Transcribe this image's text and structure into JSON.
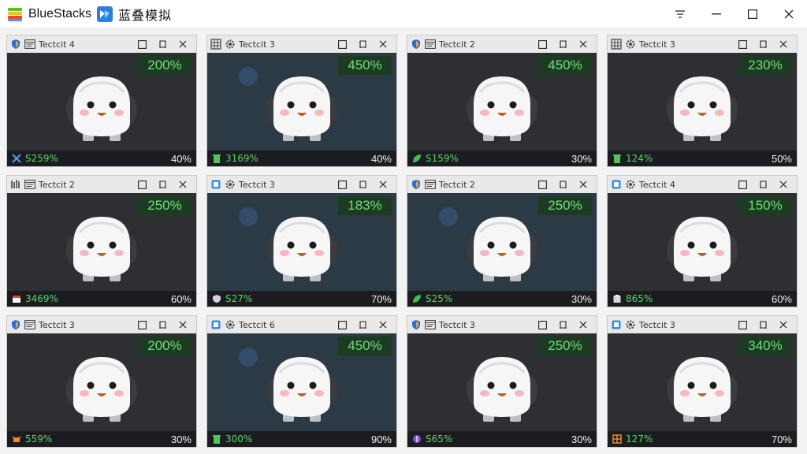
{
  "app": {
    "name": "BlueStacks",
    "alt_name": "蓝叠模拟"
  },
  "window_controls": {
    "menu_icon": "menu-icon",
    "minimize_icon": "minimize-icon",
    "maximize_icon": "maximize-icon",
    "close_icon": "close-icon"
  },
  "tiles": [
    {
      "label": "Tectcit 4",
      "zoom": "200%",
      "stat": "S259%",
      "right": "40%",
      "bg": "dark",
      "stat_icon": "cross-icon",
      "app_icon": "shield-icon"
    },
    {
      "label": "Tectcit 3",
      "zoom": "450%",
      "stat": "3169%",
      "right": "40%",
      "bg": "teal",
      "stat_icon": "trash-icon",
      "app_icon": "grid-icon"
    },
    {
      "label": "Tectcit 2",
      "zoom": "450%",
      "stat": "S159%",
      "right": "30%",
      "bg": "dark",
      "stat_icon": "leaf-icon",
      "app_icon": "shield-icon"
    },
    {
      "label": "Tectcit 3",
      "zoom": "230%",
      "stat": "124%",
      "right": "50%",
      "bg": "dark",
      "stat_icon": "trash-icon",
      "app_icon": "grid-icon"
    },
    {
      "label": "Tectcit 2",
      "zoom": "250%",
      "stat": "3469%",
      "right": "60%",
      "bg": "dark",
      "stat_icon": "calendar-icon",
      "app_icon": "bars-icon"
    },
    {
      "label": "Tectcit 3",
      "zoom": "183%",
      "stat": "S27%",
      "right": "70%",
      "bg": "teal",
      "stat_icon": "shield-small-icon",
      "app_icon": "square-icon"
    },
    {
      "label": "Tectcit 2",
      "zoom": "250%",
      "stat": "S25%",
      "right": "30%",
      "bg": "teal",
      "stat_icon": "leaf-icon",
      "app_icon": "shield-icon"
    },
    {
      "label": "Tectcit 4",
      "zoom": "150%",
      "stat": "865%",
      "right": "60%",
      "bg": "dark",
      "stat_icon": "box-icon",
      "app_icon": "square-icon"
    },
    {
      "label": "Tectcit 3",
      "zoom": "200%",
      "stat": "559%",
      "right": "30%",
      "bg": "dark",
      "stat_icon": "crab-icon",
      "app_icon": "shield-icon"
    },
    {
      "label": "Tectcit 6",
      "zoom": "450%",
      "stat": "300%",
      "right": "90%",
      "bg": "teal",
      "stat_icon": "trash-icon",
      "app_icon": "square-icon"
    },
    {
      "label": "Tectcit 3",
      "zoom": "250%",
      "stat": "S65%",
      "right": "30%",
      "bg": "dark",
      "stat_icon": "gem-icon",
      "app_icon": "shield-icon"
    },
    {
      "label": "Tectcit 3",
      "zoom": "340%",
      "stat": "127%",
      "right": "70%",
      "bg": "dark",
      "stat_icon": "ladder-icon",
      "app_icon": "square-icon"
    }
  ],
  "tile_controls": {
    "minimize_icon": "tile-minimize-icon",
    "pin_icon": "tile-pin-icon",
    "close_icon": "tile-close-icon"
  }
}
